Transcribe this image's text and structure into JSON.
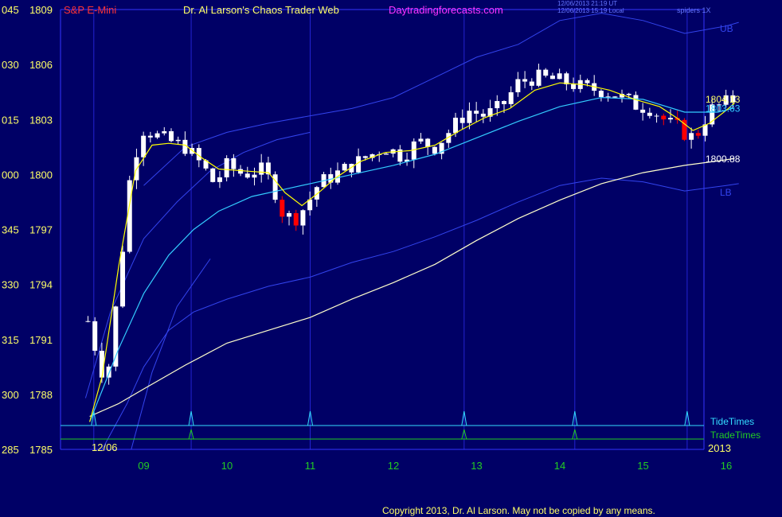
{
  "header": {
    "symbol": "S&P E-Mini",
    "site_title": "Dr. Al Larson's Chaos Trader Web",
    "site_url": "Daytradingforecasts.com",
    "stamp_utc": "12/06/2013 21:19 UT",
    "stamp_local": "12/06/2013 15:19 Local",
    "right_tag": "spiders 1X"
  },
  "footer": {
    "copyright": "Copyright 2013, Dr. Al Larson. May not be copied by any means."
  },
  "colors": {
    "background": "#000066",
    "frame": "#3333ff",
    "time_label": "#22cc22",
    "price_label": "#ffff66",
    "header_red": "#ff3333",
    "header_magenta": "#ff33ff",
    "candle_up": "#ffffff",
    "candle_down": "#ff0000",
    "ema_fast": "#ffff00",
    "ema_mid": "#33ccff",
    "ema_slow": "#ffffcc",
    "band": "#3344ee",
    "tide_line": "#33ddff",
    "trade_line": "#22cc22"
  },
  "chart_data": {
    "type": "candlestick",
    "x_ticks": [
      "09",
      "10",
      "11",
      "12",
      "13",
      "14",
      "15",
      "16"
    ],
    "date_start": "12/06",
    "year": "2013",
    "y_ticks": [
      {
        "left": "285",
        "right": "1785",
        "value": 1785
      },
      {
        "left": "300",
        "right": "1788",
        "value": 1788
      },
      {
        "left": "315",
        "right": "1791",
        "value": 1791
      },
      {
        "left": "330",
        "right": "1794",
        "value": 1794
      },
      {
        "left": "345",
        "right": "1797",
        "value": 1797
      },
      {
        "left": "000",
        "right": "1800",
        "value": 1800
      },
      {
        "left": "015",
        "right": "1803",
        "value": 1803
      },
      {
        "left": "030",
        "right": "1806",
        "value": 1806
      },
      {
        "left": "045",
        "right": "1809",
        "value": 1809
      }
    ],
    "ylim": [
      1785,
      1809
    ],
    "xlim": [
      8.3,
      16.15
    ],
    "last_values": {
      "close": "1804.13",
      "ema_mid": "1803.63",
      "ema_slow": "1800.88"
    },
    "band_labels": {
      "upper": "UB",
      "lower": "LB"
    },
    "vertical_times": [
      8.4,
      9.57,
      11.0,
      12.85,
      14.18,
      15.53
    ],
    "tide_times_label": "TideTimes",
    "tide_times": [
      8.4,
      9.57,
      11.0,
      12.85,
      14.18,
      15.53
    ],
    "trade_times_label": "TradeTimes",
    "trade_times": [
      9.57,
      12.85,
      14.18
    ],
    "series": [
      {
        "kind": "close_path",
        "x": [
          8.33,
          8.45,
          8.55,
          8.7,
          8.85,
          9.0,
          9.2,
          9.5,
          9.7,
          9.85,
          10.0,
          10.2,
          10.4,
          10.55,
          10.65,
          10.8,
          10.95,
          11.1,
          11.3,
          11.5,
          11.7,
          11.9,
          12.1,
          12.3,
          12.5,
          12.7,
          12.9,
          13.1,
          13.3,
          13.5,
          13.7,
          13.9,
          14.1,
          14.3,
          14.5,
          14.7,
          14.9,
          15.1,
          15.3,
          15.45,
          15.55,
          15.65,
          15.8,
          15.95,
          16.1
        ],
        "y": [
          1792,
          1790,
          1788.5,
          1794,
          1800.5,
          1802.5,
          1802,
          1801.5,
          1800.5,
          1799.5,
          1800.5,
          1800,
          1800.3,
          1799.5,
          1798,
          1797.5,
          1798.3,
          1799.5,
          1800,
          1800.5,
          1801,
          1801.5,
          1801,
          1801.8,
          1801.5,
          1802.5,
          1803.5,
          1803.2,
          1803.7,
          1805,
          1805.3,
          1805.2,
          1805,
          1804.7,
          1804.6,
          1804.3,
          1803.8,
          1803.6,
          1802.8,
          1802.5,
          1802,
          1802.2,
          1803.5,
          1803.8,
          1804.13
        ]
      },
      {
        "kind": "ema_fast",
        "x": [
          8.35,
          8.5,
          8.7,
          8.9,
          9.1,
          9.3,
          9.5,
          9.7,
          9.9,
          10.2,
          10.5,
          10.7,
          10.9,
          11.1,
          11.3,
          11.6,
          11.9,
          12.2,
          12.5,
          12.8,
          13.1,
          13.4,
          13.7,
          14.0,
          14.3,
          14.6,
          14.9,
          15.2,
          15.4,
          15.6,
          15.8,
          16.0,
          16.1
        ],
        "y": [
          1786.5,
          1789,
          1795,
          1800.2,
          1801.6,
          1801.7,
          1801.6,
          1800.9,
          1800.3,
          1800.2,
          1800.1,
          1799,
          1798.3,
          1799,
          1799.8,
          1800.7,
          1801.2,
          1801.3,
          1801.6,
          1802.4,
          1803.1,
          1803.6,
          1804.6,
          1805,
          1804.9,
          1804.6,
          1804.1,
          1803.7,
          1803.1,
          1802.4,
          1802.8,
          1803.5,
          1803.9
        ]
      },
      {
        "kind": "ema_mid",
        "x": [
          8.35,
          8.7,
          9.0,
          9.3,
          9.6,
          9.9,
          10.3,
          10.7,
          11.0,
          11.5,
          12.0,
          12.5,
          13.0,
          13.5,
          14.0,
          14.5,
          15.0,
          15.5,
          15.9,
          16.1
        ],
        "y": [
          1786.5,
          1790.5,
          1793.5,
          1795.6,
          1797,
          1798,
          1798.8,
          1799.2,
          1799.5,
          1800,
          1800.5,
          1801.1,
          1802,
          1802.9,
          1803.7,
          1804.2,
          1804.1,
          1803.4,
          1803.4,
          1803.63
        ]
      },
      {
        "kind": "ema_slow",
        "x": [
          8.35,
          8.7,
          9.0,
          9.5,
          10.0,
          10.5,
          11.0,
          11.5,
          12.0,
          12.5,
          13.0,
          13.5,
          14.0,
          14.5,
          15.0,
          15.5,
          16.0,
          16.1
        ],
        "y": [
          1786.8,
          1787.5,
          1788.3,
          1789.6,
          1790.8,
          1791.5,
          1792.2,
          1793.2,
          1794.1,
          1795.1,
          1796.4,
          1797.6,
          1798.6,
          1799.5,
          1800.1,
          1800.5,
          1800.8,
          1800.88
        ]
      },
      {
        "kind": "band_upper",
        "x": [
          9.0,
          9.5,
          10.0,
          10.5,
          11.0,
          11.5,
          12.0,
          12.5,
          13.0,
          13.5,
          14.0,
          14.5,
          15.0,
          15.5,
          16.0,
          16.15
        ],
        "y": [
          1799.4,
          1801.5,
          1802.3,
          1802.8,
          1803.2,
          1803.6,
          1804.2,
          1805.3,
          1806.4,
          1807.1,
          1808.4,
          1808.8,
          1808.4,
          1807.7,
          1808.1,
          1808.3
        ]
      },
      {
        "kind": "band_lower",
        "x": [
          8.5,
          8.8,
          9.0,
          9.3,
          9.6,
          10.0,
          10.5,
          11.0,
          11.5,
          12.0,
          12.5,
          13.0,
          13.5,
          14.0,
          14.5,
          15.0,
          15.5,
          16.0,
          16.15
        ],
        "y": [
          1785,
          1787.5,
          1789.5,
          1791.5,
          1792.5,
          1793.2,
          1793.9,
          1794.4,
          1795.2,
          1795.8,
          1796.6,
          1797.5,
          1798.5,
          1799.4,
          1799.8,
          1799.6,
          1799.1,
          1799.4,
          1799.5
        ]
      },
      {
        "kind": "band_outer",
        "x": [
          8.3,
          8.6,
          9.0,
          9.4,
          9.8,
          10.2,
          10.6,
          11.0
        ],
        "y": [
          1787.8,
          1792.5,
          1796.5,
          1798.5,
          1800.2,
          1801.2,
          1801.9,
          1802.3
        ]
      },
      {
        "kind": "band_inner",
        "x": [
          8.85,
          9.1,
          9.4,
          9.8
        ],
        "y": [
          1785,
          1789.2,
          1792.8,
          1795.4
        ]
      }
    ]
  }
}
